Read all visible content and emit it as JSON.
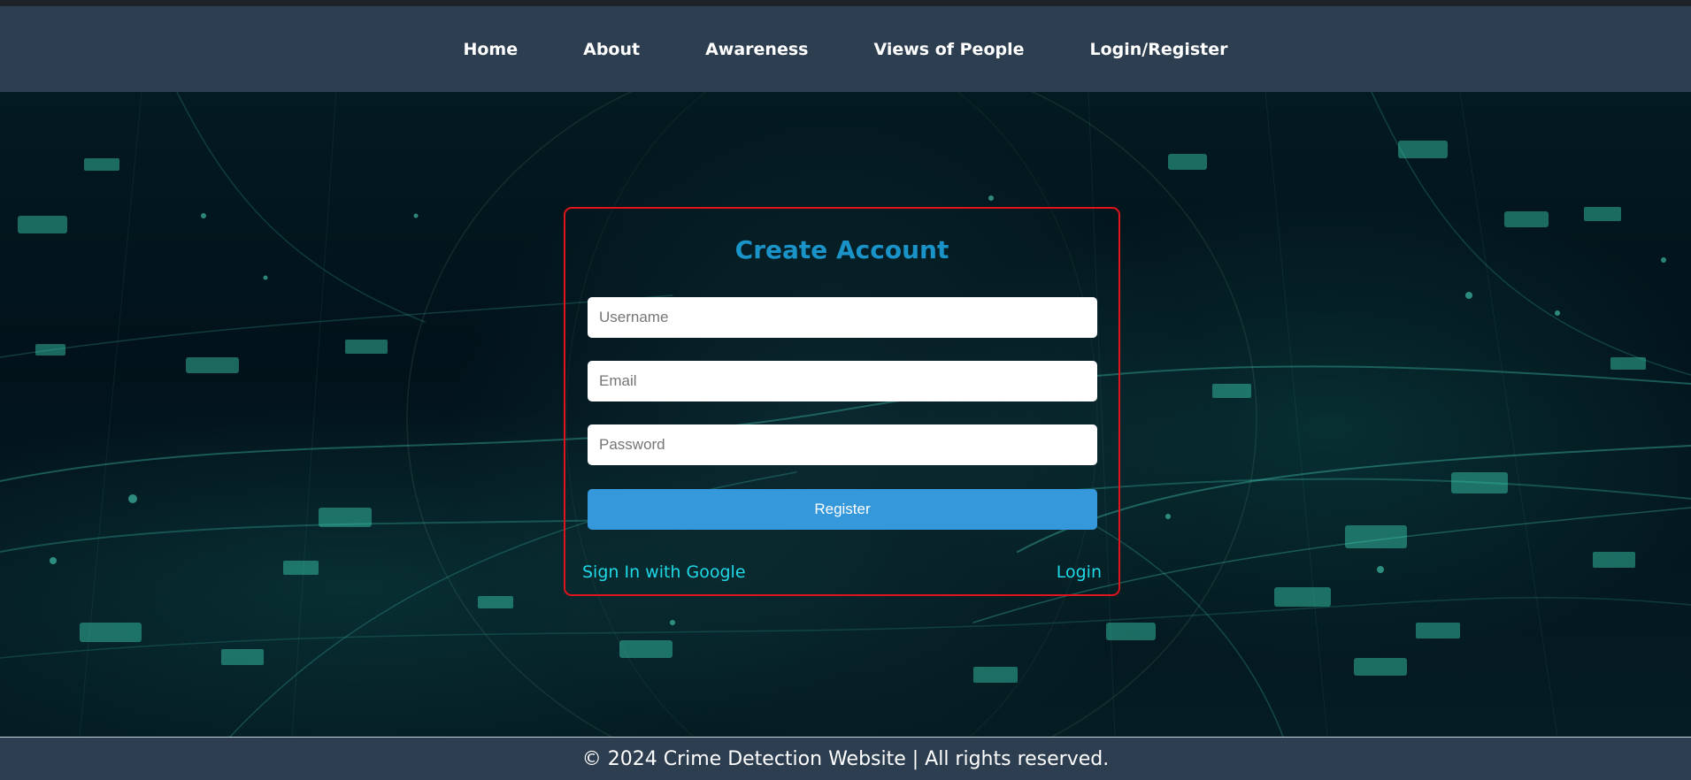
{
  "nav": {
    "items": [
      {
        "label": "Home"
      },
      {
        "label": "About"
      },
      {
        "label": "Awareness"
      },
      {
        "label": "Views of People"
      },
      {
        "label": "Login/Register"
      }
    ]
  },
  "form": {
    "title": "Create Account",
    "username_placeholder": "Username",
    "email_placeholder": "Email",
    "password_placeholder": "Password",
    "register_label": "Register",
    "google_link": "Sign In with Google",
    "login_link": "Login"
  },
  "footer": {
    "text": "© 2024 Crime Detection Website | All rights reserved."
  },
  "colors": {
    "navbar": "#2d3e50",
    "card_border": "#e0141c",
    "title": "#1a93c9",
    "register_button": "#3498db",
    "links": "#1fd8e6"
  }
}
